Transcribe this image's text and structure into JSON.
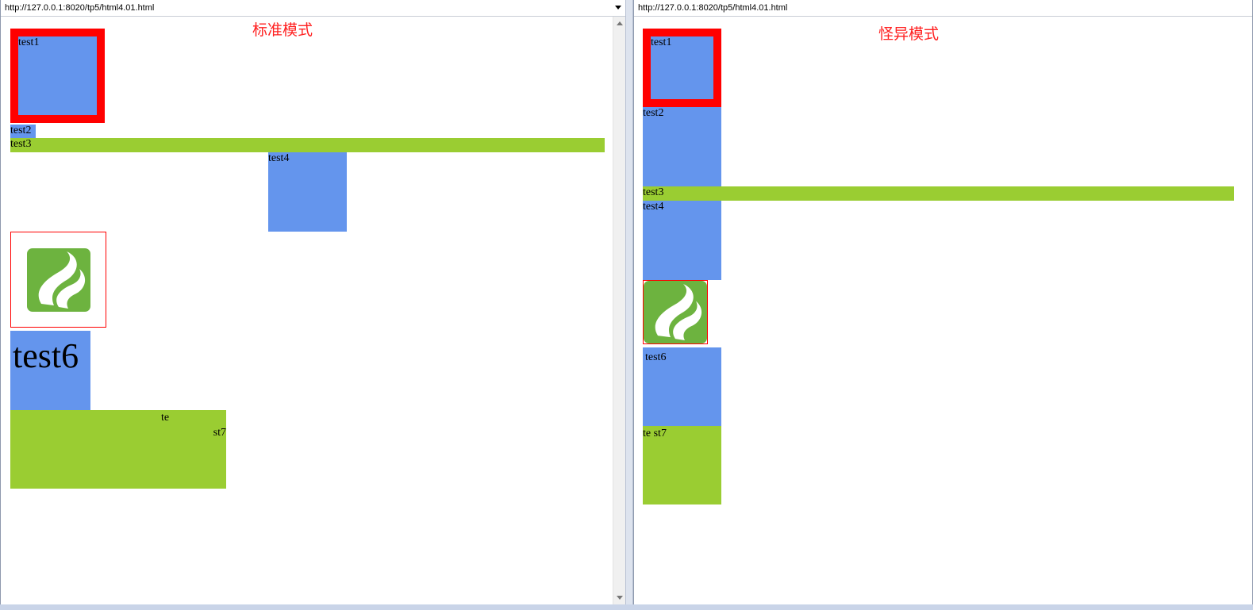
{
  "left_pane": {
    "url": "http://127.0.0.1:8020/tp5/html4.01.html",
    "mode_title": "标准模式",
    "boxes": {
      "test1": "test1",
      "test2": "test2",
      "test3": "test3",
      "test4": "test4",
      "test6": "test6",
      "test7_part1": "te",
      "test7_part2": "st7"
    }
  },
  "right_pane": {
    "url": "http://127.0.0.1:8020/tp5/html4.01.html",
    "mode_title": "怪异模式",
    "boxes": {
      "test1": "test1",
      "test2": "test2",
      "test3": "test3",
      "test4": "test4",
      "test6": "test6",
      "test7": "te st7"
    }
  },
  "colors": {
    "box_blue": "#6495ed",
    "box_green": "#9acd32",
    "border_red": "#ff0000",
    "title_red": "#ff2020",
    "logo_green": "#6db33f"
  },
  "icons": {
    "url_dropdown": "chevron-down-icon",
    "logo": "flame-logo-icon",
    "scroll_up": "scroll-up-arrow-icon",
    "scroll_down": "scroll-down-arrow-icon"
  }
}
